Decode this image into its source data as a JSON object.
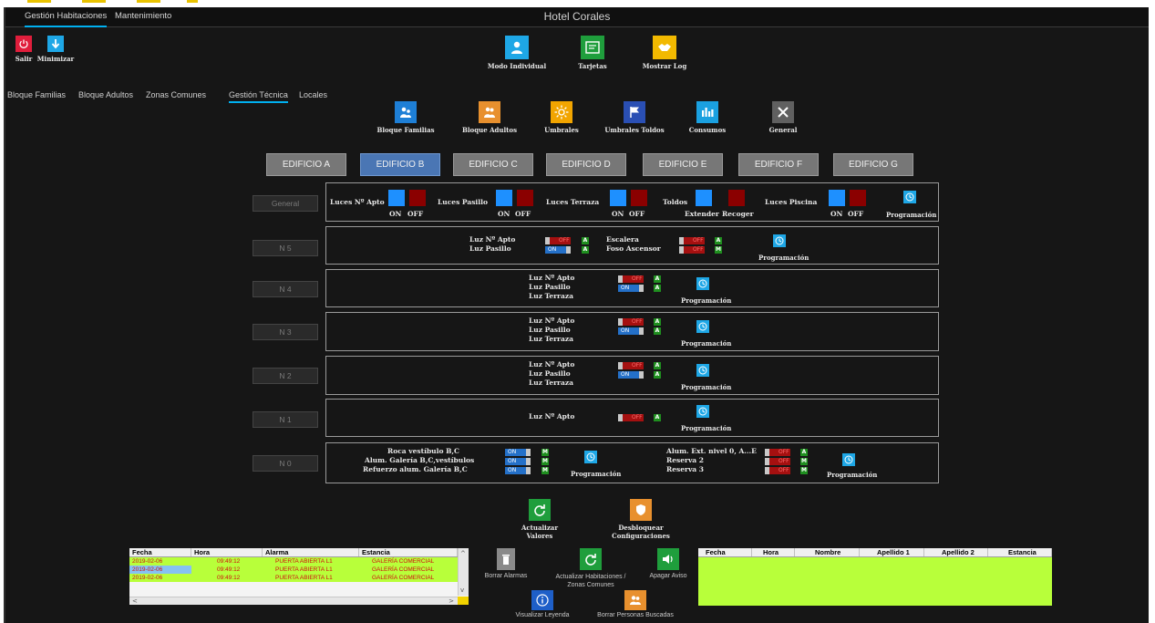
{
  "titlebar": {
    "tabs": [
      {
        "label": "Gestión Habitaciones",
        "active": true
      },
      {
        "label": "Mantenimiento",
        "active": false
      }
    ],
    "title": "Hotel Corales"
  },
  "toolbar": {
    "exit_label": "Salir",
    "minimize_label": "Minimizar",
    "individual_label": "Modo Individual",
    "cards_label": "Tarjetas",
    "log_label": "Mostrar Log"
  },
  "subtabs": [
    {
      "label": "Bloque Familias",
      "active": false
    },
    {
      "label": "Bloque Adultos",
      "active": false
    },
    {
      "label": "Zonas Comunes",
      "active": false
    },
    {
      "label": "Gestión Técnica",
      "active": true
    },
    {
      "label": "Locales",
      "active": false
    }
  ],
  "tech_tiles": [
    {
      "label": "Bloque Familias",
      "color": "#1e7fd6",
      "icon": "family-icon"
    },
    {
      "label": "Bloque Adultos",
      "color": "#e8902e",
      "icon": "adults-icon"
    },
    {
      "label": "Umbrales",
      "color": "#f2a500",
      "icon": "sun-icon"
    },
    {
      "label": "Umbrales Toldos",
      "color": "#2a4fb4",
      "icon": "flag-icon"
    },
    {
      "label": "Consumos",
      "color": "#1aa0e0",
      "icon": "bar-chart-icon"
    },
    {
      "label": "General",
      "color": "#606060",
      "icon": "tools-icon"
    }
  ],
  "buildings": [
    {
      "label": "EDIFICIO A",
      "selected": false
    },
    {
      "label": "EDIFICIO B",
      "selected": true
    },
    {
      "label": "EDIFICIO C",
      "selected": false
    },
    {
      "label": "EDIFICIO D",
      "selected": false
    },
    {
      "label": "EDIFICIO E",
      "selected": false
    },
    {
      "label": "EDIFICIO F",
      "selected": false
    },
    {
      "label": "EDIFICIO G",
      "selected": false
    }
  ],
  "levels": [
    "General",
    "N 5",
    "N 4",
    "N 3",
    "N 2",
    "N 1",
    "N 0"
  ],
  "general_panel": {
    "groups": [
      {
        "label": "Luces Nº Apto",
        "a": "ON",
        "b": "OFF"
      },
      {
        "label": "Luces Pasillo",
        "a": "ON",
        "b": "OFF"
      },
      {
        "label": "Luces Terraza",
        "a": "ON",
        "b": "OFF"
      },
      {
        "label": "Toldos",
        "a": "Extender",
        "b": "Recoger"
      },
      {
        "label": "Luces Piscina",
        "a": "ON",
        "b": "OFF"
      }
    ],
    "programacion": "Programación"
  },
  "n5": {
    "luz_apto": "Luz Nº Apto",
    "luz_pasillo": "Luz Pasillo",
    "escalera": "Escalera",
    "foso": "Foso Ascensor",
    "off": "OFF",
    "on": "ON",
    "a": "A",
    "m": "M",
    "programacion": "Programación"
  },
  "floor_std": {
    "luz_apto": "Luz Nº Apto",
    "luz_pasillo": "Luz Pasillo",
    "luz_terraza": "Luz Terraza",
    "off": "OFF",
    "on": "ON",
    "a": "A",
    "programacion": "Programación"
  },
  "n0": {
    "left": [
      "Roca vestíbulo B,C",
      "Alum. Galería B,C,vestíbulos",
      "Refuerzo alum. Galería B,C"
    ],
    "right": [
      "Alum. Ext. nivel 0, A...E",
      "Reserva 2",
      "Reserva 3"
    ],
    "on": "ON",
    "off": "OFF",
    "a": "A",
    "m": "M",
    "programacion": "Programación"
  },
  "actions": {
    "refresh_label": "Actualizar Valores",
    "unlock_label": "Desbloquear Configuraciones"
  },
  "alarms": {
    "headers": [
      "Fecha",
      "Hora",
      "Alarma",
      "Estancia"
    ],
    "rows": [
      [
        "2019-02-06",
        "09:49:12",
        "PUERTA ABIERTA L1",
        "GALERÍA COMERCIAL"
      ],
      [
        "2019-02-06",
        "09:49:12",
        "PUERTA ABIERTA L1",
        "GALERÍA COMERCIAL"
      ],
      [
        "2019-02-06",
        "09:49:12",
        "PUERTA ABIERTA L1",
        "GALERÍA COMERCIAL"
      ]
    ]
  },
  "bottom_actions": {
    "delete_alarms": "Borrar Alarmas",
    "refresh_rooms": "Actualizar Habitaciones / Zonas Comunes",
    "mute": "Apagar Aviso",
    "legend": "Visualizar Leyenda",
    "delete_people": "Borrar Personas Buscadas"
  },
  "persons": {
    "headers": [
      "Fecha",
      "Hora",
      "Nombre",
      "Apellido 1",
      "Apellido 2",
      "Estancia"
    ]
  },
  "colors": {
    "background": "#161616",
    "accent_blue": "#1e90ff",
    "off_red": "#8b0000",
    "status_green": "#1f8f1f",
    "table_green": "#b8ff3a"
  }
}
